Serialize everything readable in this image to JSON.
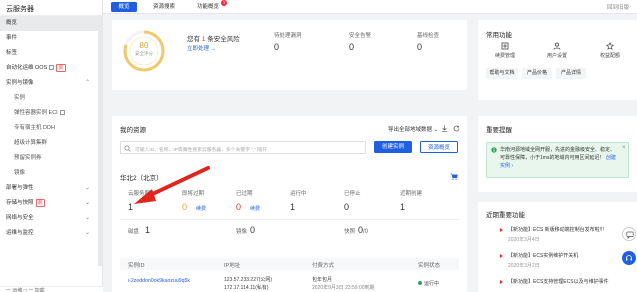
{
  "sidebar": {
    "title": "云服务器",
    "items": [
      {
        "label": "概览",
        "active": true
      },
      {
        "label": "事件"
      },
      {
        "label": "标签"
      },
      {
        "label": "自动化运维 OOS",
        "ext": true,
        "tag": "新"
      },
      {
        "label": "实例与镜像",
        "chevron": "^"
      },
      {
        "label": "实例",
        "sub": true
      },
      {
        "label": "弹性容器实例 ECI",
        "sub": true,
        "ext": true
      },
      {
        "label": "专有宿主机 DDH",
        "sub": true
      },
      {
        "label": "超级计算集群",
        "sub": true
      },
      {
        "label": "预留实例券",
        "sub": true
      },
      {
        "label": "镜像",
        "sub": true
      },
      {
        "label": "部署与弹性",
        "chevron": "v"
      },
      {
        "label": "存储与快照",
        "tag": "新",
        "chevron": "v"
      },
      {
        "label": "网络与安全",
        "chevron": "v"
      },
      {
        "label": "运维与监控",
        "chevron": "v"
      }
    ],
    "bottom": "一 运维  □ 一 加载"
  },
  "topbar": {
    "tabs": [
      "概览",
      "资源搜索",
      "功能概览"
    ],
    "badge": "3",
    "right": "回到旧版"
  },
  "security": {
    "score": "80",
    "score_label": "安全评分",
    "risk_prefix": "您有",
    "risk_count": "1",
    "risk_suffix": "条安全风险",
    "fix_link": "立即处理 →",
    "metrics": [
      {
        "label": "待处理漏洞",
        "value": "0"
      },
      {
        "label": "安全告警",
        "value": "0"
      },
      {
        "label": "基线检查",
        "value": "0"
      }
    ]
  },
  "common": {
    "title": "常用功能",
    "icons": [
      {
        "label": "续费管理",
        "icon": "renew-icon"
      },
      {
        "label": "用户设置",
        "icon": "user-settings-icon"
      },
      {
        "label": "权益配额",
        "icon": "quota-icon"
      }
    ],
    "links": [
      "帮助与文档",
      "产品价格",
      "产品详情"
    ]
  },
  "resources": {
    "title": "我的资源",
    "export_label": "导出全部地域数据",
    "search_placeholder": "可输入ID、名称、IP等属性搜索云服务器，多个关键字 \",\" 隔开",
    "create_btn": "创建实例",
    "overview_btn": "资源概览",
    "region": "华北2（北京）",
    "stats": [
      {
        "label": "云服务器",
        "value": "1"
      },
      {
        "label": "即将过期",
        "value": "0",
        "link": "续费",
        "color": "#f5a623"
      },
      {
        "label": "已过期",
        "value": "0",
        "link": "续费",
        "color": "#e33"
      },
      {
        "label": "运行中",
        "value": "1"
      },
      {
        "label": "已停止",
        "value": "0"
      },
      {
        "label": "近期创建",
        "value": "1"
      }
    ],
    "stats2": [
      {
        "label": "磁盘",
        "value": "1"
      },
      {
        "label": "镜像",
        "value": "0"
      },
      {
        "label": "快照",
        "value": "0",
        "suffix": "/0"
      }
    ],
    "table_headers": [
      "实例ID",
      "IP地址",
      "付费方式",
      "实例状态"
    ],
    "row": {
      "id": "i-2zeddon0ok9kaozuu9q5k",
      "ip1": "123.57.233.227(公网)",
      "ip2": "172.17.114.11(私有)",
      "pay1": "包年包月",
      "pay2": "2020年9月3日 23:59:00到期",
      "status": "运行中"
    }
  },
  "alerts": {
    "title": "重要提醒",
    "notice": "华南河源地域全网开服，先进的金融级安全、稳定、可靠性保障，小于1ms的地域内可用区间延迟！",
    "notice_link": "创建实例 ›"
  },
  "news": {
    "title": "近期重要功能",
    "items": [
      {
        "title": "【新功能】ECS 新版移动端控制台发布啦!!!",
        "date": "2020年3月4日"
      },
      {
        "title": "【新功能】ECS实例维护开关机",
        "date": "2020年3月2日"
      },
      {
        "title": "【新功能】ECS支持管理ECS以及与维护事件",
        "date": ""
      }
    ]
  },
  "colors": {
    "accent": "#1f5fe0",
    "danger": "#e33",
    "warn": "#f5a623",
    "success": "#2ea65a",
    "gauge": "#f0c96b"
  },
  "annotation": {
    "type": "red-arrow",
    "points_to": "云服务器 count"
  }
}
